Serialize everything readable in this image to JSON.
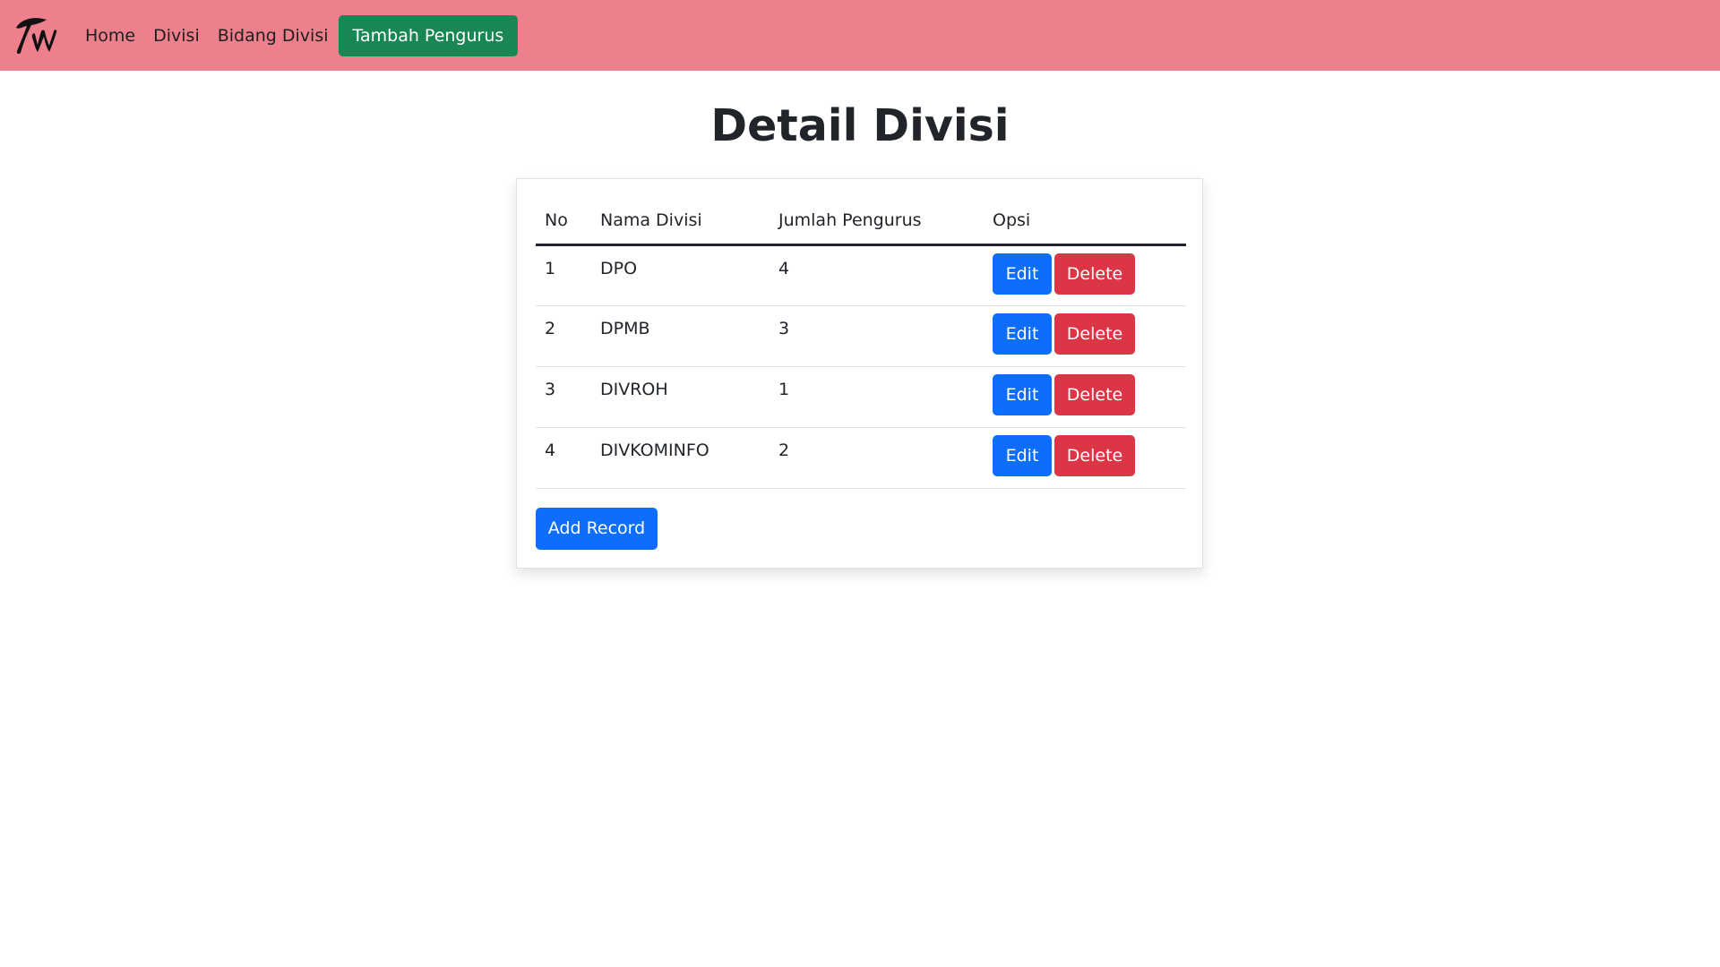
{
  "nav": {
    "links": [
      "Home",
      "Divisi",
      "Bidang Divisi"
    ],
    "cta_label": "Tambah Pengurus",
    "bg_color": "#ee7f8c",
    "cta_color": "#198754"
  },
  "logo": {
    "icon": "twice-logo-icon"
  },
  "page": {
    "title": "Detail Divisi"
  },
  "table": {
    "headers": [
      "No",
      "Nama Divisi",
      "Jumlah Pengurus",
      "Opsi"
    ],
    "rows": [
      {
        "no": "1",
        "nama": "DPO",
        "jumlah": "4",
        "edit": "Edit",
        "delete": "Delete"
      },
      {
        "no": "2",
        "nama": "DPMB",
        "jumlah": "3",
        "edit": "Edit",
        "delete": "Delete"
      },
      {
        "no": "3",
        "nama": "DIVROH",
        "jumlah": "1",
        "edit": "Edit",
        "delete": "Delete"
      },
      {
        "no": "4",
        "nama": "DIVKOMINFO",
        "jumlah": "2",
        "edit": "Edit",
        "delete": "Delete"
      }
    ]
  },
  "actions": {
    "add_record_label": "Add Record"
  },
  "colors": {
    "primary": "#0d6efd",
    "danger": "#dc3545"
  }
}
